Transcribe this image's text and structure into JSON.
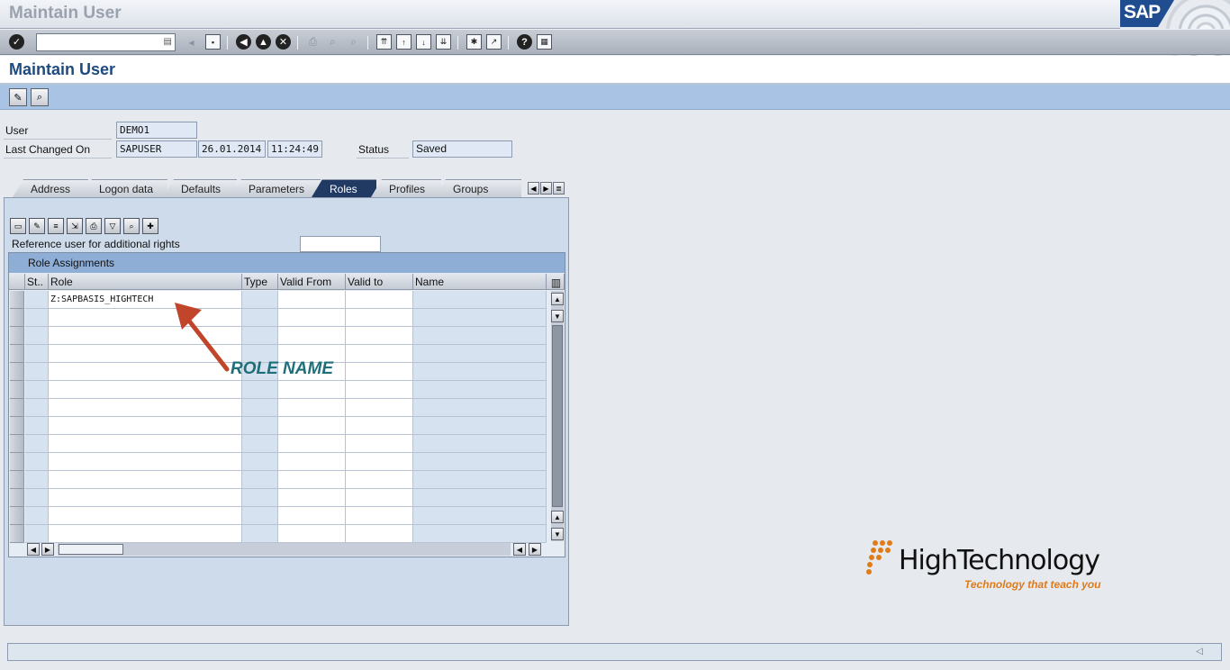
{
  "window": {
    "title": "Maintain User"
  },
  "brand": {
    "sap_logo": "SAP"
  },
  "toolbar": {
    "command_field_value": "",
    "icons": [
      "enter-icon",
      "save-icon",
      "back-icon",
      "exit-icon",
      "cancel-icon",
      "print-icon",
      "find-icon",
      "find-next-icon",
      "first-page-icon",
      "previous-page-icon",
      "next-page-icon",
      "last-page-icon",
      "new-session-icon",
      "shortcut-icon",
      "help-icon",
      "layout-menu-icon"
    ]
  },
  "screen": {
    "title": "Maintain User"
  },
  "app_toolbar": {
    "icons": [
      "display-change-icon",
      "other-user-icon"
    ]
  },
  "header": {
    "user_label": "User",
    "user_value": "DEMO1",
    "last_changed_label": "Last Changed On",
    "last_changed_by": "SAPUSER",
    "last_changed_date": "26.01.2014",
    "last_changed_time": "11:24:49",
    "status_label": "Status",
    "status_value": "Saved"
  },
  "tabs": [
    {
      "label": "Address",
      "active": false
    },
    {
      "label": "Logon data",
      "active": false
    },
    {
      "label": "Defaults",
      "active": false
    },
    {
      "label": "Parameters",
      "active": false
    },
    {
      "label": "Roles",
      "active": true
    },
    {
      "label": "Profiles",
      "active": false
    },
    {
      "label": "Groups",
      "active": false
    }
  ],
  "roles_tab": {
    "reference_user_label": "Reference user for additional rights",
    "reference_user_value": "",
    "grid": {
      "title": "Role Assignments",
      "columns": [
        "St..",
        "Role",
        "Type",
        "Valid From",
        "Valid to",
        "Name"
      ],
      "rows": [
        [
          "",
          "Z:SAPBASIS_HIGHTECH",
          "",
          "",
          "",
          ""
        ],
        [
          "",
          "",
          "",
          "",
          "",
          ""
        ],
        [
          "",
          "",
          "",
          "",
          "",
          ""
        ],
        [
          "",
          "",
          "",
          "",
          "",
          ""
        ],
        [
          "",
          "",
          "",
          "",
          "",
          ""
        ],
        [
          "",
          "",
          "",
          "",
          "",
          ""
        ],
        [
          "",
          "",
          "",
          "",
          "",
          ""
        ],
        [
          "",
          "",
          "",
          "",
          "",
          ""
        ],
        [
          "",
          "",
          "",
          "",
          "",
          ""
        ],
        [
          "",
          "",
          "",
          "",
          "",
          ""
        ],
        [
          "",
          "",
          "",
          "",
          "",
          ""
        ],
        [
          "",
          "",
          "",
          "",
          "",
          ""
        ],
        [
          "",
          "",
          "",
          "",
          "",
          ""
        ],
        [
          "",
          "",
          "",
          "",
          "",
          ""
        ]
      ]
    }
  },
  "annotation": {
    "text": "ROLE NAME",
    "color": "#1e6f7a",
    "arrow_color": "#c0452a"
  },
  "watermark": {
    "name": "HighTechnology",
    "tagline": "Technology that teach you",
    "accent": "#e07b18"
  },
  "status_bar": {
    "message": ""
  }
}
